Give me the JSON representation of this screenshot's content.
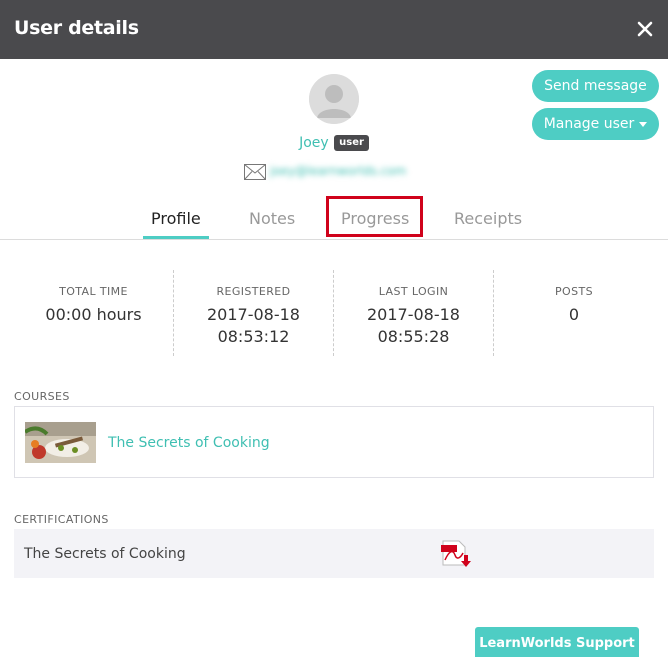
{
  "header": {
    "title": "User details"
  },
  "user": {
    "name": "Joey",
    "role": "user",
    "email": "joey@learnworlds.com"
  },
  "actions": {
    "send_message": "Send message",
    "manage_user": "Manage user"
  },
  "tabs": [
    {
      "label": "Profile",
      "active": true
    },
    {
      "label": "Notes",
      "active": false
    },
    {
      "label": "Progress",
      "active": false
    },
    {
      "label": "Receipts",
      "active": false
    }
  ],
  "stats": [
    {
      "label": "TOTAL TIME",
      "value": "00:00 hours"
    },
    {
      "label": "REGISTERED",
      "value_line1": "2017-08-18",
      "value_line2": "08:53:12"
    },
    {
      "label": "LAST LOGIN",
      "value_line1": "2017-08-18",
      "value_line2": "08:55:28"
    },
    {
      "label": "POSTS",
      "value": "0"
    }
  ],
  "courses": {
    "label": "COURSES",
    "items": [
      {
        "title": "The Secrets of Cooking"
      }
    ]
  },
  "certifications": {
    "label": "CERTIFICATIONS",
    "items": [
      {
        "title": "The Secrets of Cooking"
      }
    ]
  },
  "support": {
    "label": "LearnWorlds Support"
  },
  "colors": {
    "header_bg": "#4a4a4d",
    "accent": "#4ecdc4",
    "link": "#3fbfb2",
    "highlight": "#d0021b"
  },
  "icons": [
    "close-icon",
    "avatar-placeholder-icon",
    "mail-icon",
    "caret-down-icon",
    "pdf-download-icon"
  ]
}
